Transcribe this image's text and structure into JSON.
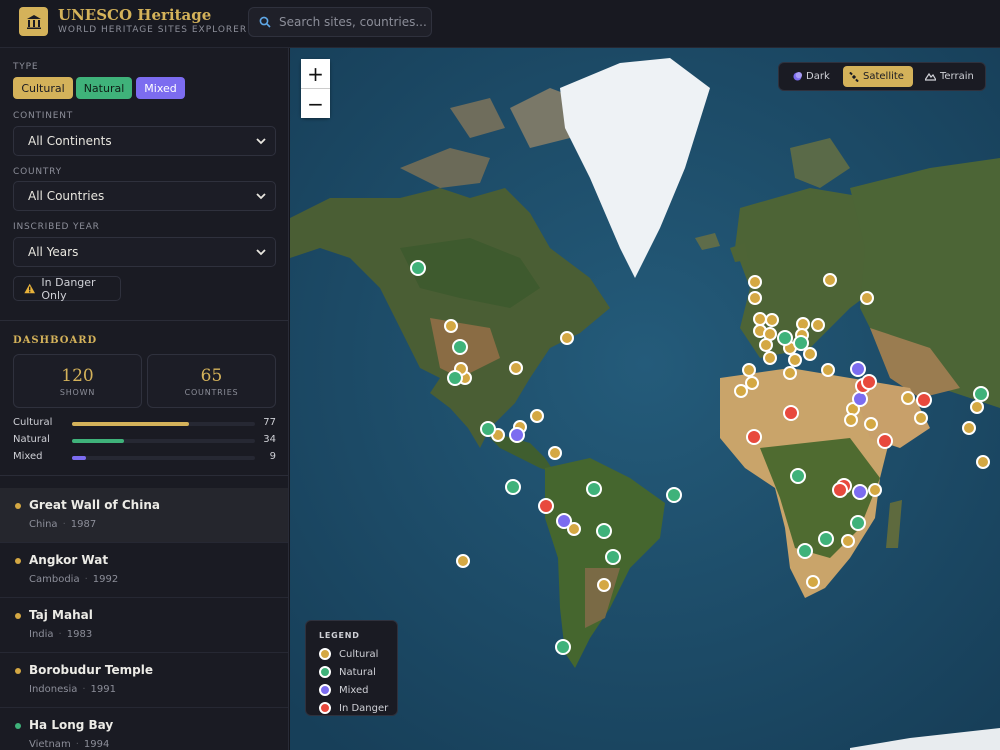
{
  "header": {
    "title": "UNESCO Heritage",
    "subtitle": "WORLD HERITAGE SITES EXPLORER",
    "search_placeholder": "Search sites, countries..."
  },
  "filters": {
    "type_label": "TYPE",
    "types": [
      {
        "label": "Cultural",
        "color": "#d4b25a",
        "text_color": "#1a1b23"
      },
      {
        "label": "Natural",
        "color": "#3fb27a",
        "text_color": "#0f1f17"
      },
      {
        "label": "Mixed",
        "color": "#7c6cf0",
        "text_color": "#ffffff"
      }
    ],
    "continent_label": "CONTINENT",
    "continent_value": "All Continents",
    "country_label": "COUNTRY",
    "country_value": "All Countries",
    "year_label": "INSCRIBED YEAR",
    "year_value": "All Years",
    "danger_label": "In Danger Only"
  },
  "dashboard": {
    "title": "DASHBOARD",
    "shown_value": "120",
    "shown_label": "SHOWN",
    "countries_value": "65",
    "countries_label": "COUNTRIES",
    "bars": [
      {
        "label": "Cultural",
        "value": 77,
        "color": "#d4b25a"
      },
      {
        "label": "Natural",
        "value": 34,
        "color": "#3fb27a"
      },
      {
        "label": "Mixed",
        "value": 9,
        "color": "#7c6cf0"
      }
    ],
    "bar_max": 120
  },
  "sites": [
    {
      "name": "Great Wall of China",
      "country": "China",
      "year": "1987",
      "type": "cultural",
      "active": true
    },
    {
      "name": "Angkor Wat",
      "country": "Cambodia",
      "year": "1992",
      "type": "cultural",
      "active": false
    },
    {
      "name": "Taj Mahal",
      "country": "India",
      "year": "1983",
      "type": "cultural",
      "active": false
    },
    {
      "name": "Borobudur Temple",
      "country": "Indonesia",
      "year": "1991",
      "type": "cultural",
      "active": false
    },
    {
      "name": "Ha Long Bay",
      "country": "Vietnam",
      "year": "1994",
      "type": "natural",
      "active": false
    }
  ],
  "map": {
    "zoom_in": "+",
    "zoom_out": "−",
    "styles": [
      {
        "label": "Dark",
        "icon": "moon-icon",
        "active": false
      },
      {
        "label": "Satellite",
        "icon": "satellite-icon",
        "active": true
      },
      {
        "label": "Terrain",
        "icon": "terrain-icon",
        "active": false
      }
    ],
    "legend": {
      "title": "LEGEND",
      "items": [
        {
          "label": "Cultural",
          "color": "#d4a843"
        },
        {
          "label": "Natural",
          "color": "#3fb27a"
        },
        {
          "label": "Mixed",
          "color": "#7c6cf0"
        },
        {
          "label": "In Danger",
          "color": "#e8493d"
        }
      ]
    }
  },
  "colors": {
    "accent": "#d4b25a",
    "cultural": "#d4a843",
    "natural": "#3fb27a",
    "mixed": "#7c6cf0",
    "danger": "#e8493d"
  }
}
